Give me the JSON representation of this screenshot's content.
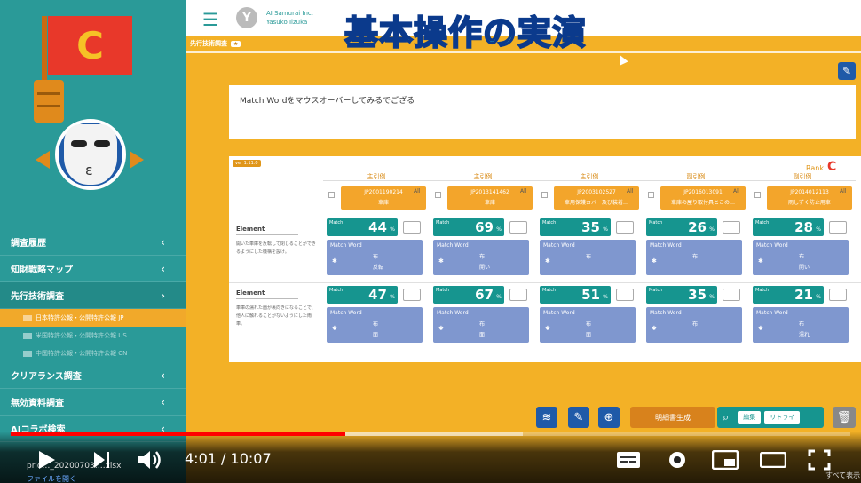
{
  "overlay_title": "基本操作の実演",
  "user": {
    "avatar_letter": "Y",
    "company": "AI Samurai Inc.",
    "name": "Yasuko Iizuka"
  },
  "flag_letter": "C",
  "sidebar": {
    "items": [
      {
        "label": "調査履歴",
        "chevron": "‹"
      },
      {
        "label": "知財戦略マップ",
        "chevron": "‹"
      },
      {
        "label": "先行技術調査",
        "chevron": "›"
      },
      {
        "label": "クリアランス調査",
        "chevron": "‹"
      },
      {
        "label": "無効資料調査",
        "chevron": "‹"
      },
      {
        "label": "AIコラボ検索",
        "chevron": "‹"
      }
    ],
    "sub_items": [
      "日本特許公報・公開特許公報 JP",
      "米国特許公報・公開特許公報 US",
      "中国特許公報・公開特許公報 CN"
    ]
  },
  "breadcrumb": {
    "label": "先行技術調査",
    "badge": "★"
  },
  "query_text": "Match Wordをマウスオーバーしてみるでござる",
  "panel": {
    "version": "ver 1.11.0",
    "rank_label": "Rank",
    "rank_value": "C",
    "all_label": "All",
    "match_label": "Match",
    "match_word_label": "Match Word",
    "pct": "%",
    "columns": [
      {
        "head": "主引例",
        "patent": "JP2001190214",
        "title": "車庫"
      },
      {
        "head": "主引例",
        "patent": "JP2013141462",
        "title": "車庫"
      },
      {
        "head": "主引例",
        "patent": "JP2003102527",
        "title": "車用保護カバー及び装着…"
      },
      {
        "head": "副引例",
        "patent": "JP2016013091",
        "title": "車庫の屋り取付具とこの…"
      },
      {
        "head": "副引例",
        "patent": "JP2014012113",
        "title": "雨しずく防止用車"
      }
    ],
    "rows": [
      {
        "element_label": "Element",
        "element_text": "開いた車庫を反転して閉じることができるようにした機構を設け。",
        "matches": [
          44,
          69,
          35,
          26,
          28
        ],
        "words": [
          [
            "布",
            "反転"
          ],
          [
            "布",
            "開い"
          ],
          [
            "布",
            ""
          ],
          [
            "布",
            ""
          ],
          [
            "布",
            "開い"
          ]
        ]
      },
      {
        "element_label": "Element",
        "element_text": "車庫の濡れた面が裏向きになることで、他人に触れることがないようにした雨車。",
        "matches": [
          47,
          67,
          51,
          35,
          21
        ],
        "words": [
          [
            "布",
            "面"
          ],
          [
            "布",
            "面"
          ],
          [
            "布",
            "面"
          ],
          [
            "布",
            ""
          ],
          [
            "布",
            "濡れ"
          ]
        ]
      }
    ]
  },
  "toolbar": {
    "generate_label": "明細書生成",
    "edit_label": "編集",
    "retry_label": "リトライ"
  },
  "player": {
    "progress_played": 0.399,
    "progress_buffered": 0.61,
    "time_current": "4:01",
    "time_separator": "/",
    "time_total": "10:07",
    "file_name": "prio…_20200703….xlsx",
    "file_open": "ファイルを開く",
    "show_all": "すべて表示"
  },
  "colors": {
    "sidebar": "#2a9a98",
    "main_bg": "#f3b126",
    "match_box": "#16958f",
    "match_word_box": "#7f97cf",
    "progress": "#ff0000"
  }
}
